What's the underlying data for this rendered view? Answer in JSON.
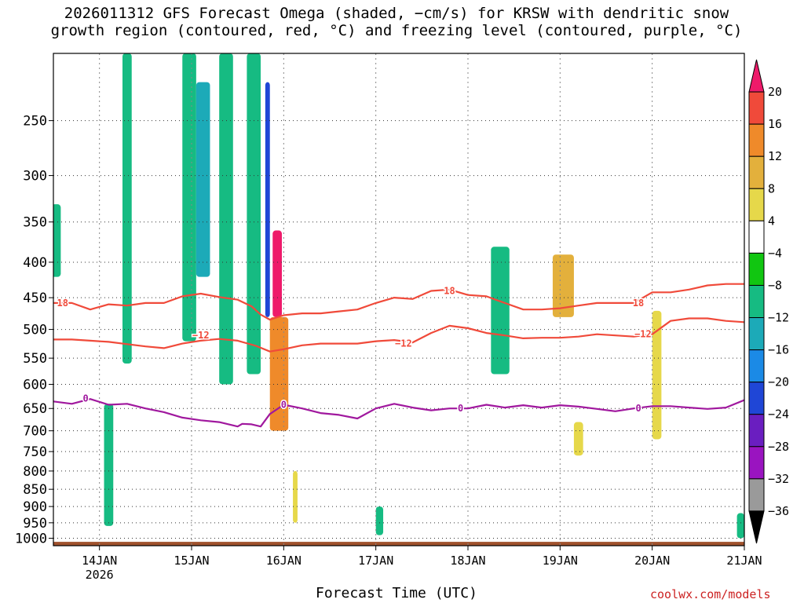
{
  "title": "2026011312 GFS Forecast Omega (shaded, −cm/s) for KRSW with dendritic snow\ngrowth region (contoured, red, °C) and freezing level (contoured, purple, °C)",
  "credit": "coolwx.com/models",
  "chart_data": {
    "type": "heatmap",
    "title": "2026011312 GFS Forecast Omega (shaded, −cm/s) for KRSW with dendritic snow growth region (contoured, red, °C) and freezing level (contoured, purple, °C)",
    "xlabel": "Forecast Time (UTC)",
    "ylabel": "",
    "y_scale": "log",
    "ylim": [
      1025,
      200
    ],
    "xlim": [
      "2026-01-13T12",
      "2026-01-21T00"
    ],
    "x_ticks": [
      {
        "label": "14JAN",
        "sub": "2026",
        "day": 14
      },
      {
        "label": "15JAN",
        "sub": "",
        "day": 15
      },
      {
        "label": "16JAN",
        "sub": "",
        "day": 16
      },
      {
        "label": "17JAN",
        "sub": "",
        "day": 17
      },
      {
        "label": "18JAN",
        "sub": "",
        "day": 18
      },
      {
        "label": "19JAN",
        "sub": "",
        "day": 19
      },
      {
        "label": "20JAN",
        "sub": "",
        "day": 20
      },
      {
        "label": "21JAN",
        "sub": "",
        "day": 21
      }
    ],
    "y_ticks": [
      250,
      300,
      350,
      400,
      450,
      500,
      550,
      600,
      650,
      700,
      750,
      800,
      850,
      900,
      950,
      1000
    ],
    "colorbar": {
      "labels": [
        "20",
        "16",
        "12",
        "8",
        "4",
        "−4",
        "−8",
        "−12",
        "−16",
        "−20",
        "−24",
        "−28",
        "−32",
        "−36"
      ],
      "colors": [
        "#ee1a6a",
        "#f04a3a",
        "#ef8a2a",
        "#e3b03c",
        "#e6d84a",
        "#ffffff",
        "#11c611",
        "#16bb82",
        "#1caab8",
        "#1b8ae6",
        "#1f46d6",
        "#6a1ec0",
        "#9a14c0",
        "#9a9a9a",
        "#000000"
      ]
    },
    "contours": [
      {
        "name": "-18",
        "color": "#f04a3a",
        "label": "18",
        "x": [
          13.5,
          13.7,
          13.9,
          14.1,
          14.3,
          14.5,
          14.7,
          14.9,
          15.1,
          15.3,
          15.5,
          15.65,
          15.75,
          15.85,
          16.0,
          16.2,
          16.4,
          16.6,
          16.8,
          17.0,
          17.2,
          17.4,
          17.6,
          17.8,
          18.0,
          18.2,
          18.4,
          18.6,
          18.8,
          19.0,
          19.2,
          19.4,
          19.6,
          19.8,
          20.0,
          20.2,
          20.4,
          20.6,
          20.8,
          21.0
        ],
        "y": [
          458,
          458,
          468,
          460,
          462,
          458,
          458,
          448,
          444,
          449,
          453,
          463,
          476,
          484,
          477,
          474,
          474,
          471,
          468,
          458,
          450,
          452,
          440,
          438,
          446,
          448,
          458,
          468,
          468,
          466,
          462,
          458,
          458,
          458,
          442,
          442,
          438,
          432,
          430,
          430
        ],
        "label_at": [
          [
            13.6,
            458
          ],
          [
            17.8,
            440
          ],
          [
            19.85,
            458
          ]
        ]
      },
      {
        "name": "-12",
        "color": "#f04a3a",
        "label": "−12",
        "x": [
          13.5,
          13.7,
          13.9,
          14.1,
          14.3,
          14.5,
          14.7,
          14.9,
          15.1,
          15.3,
          15.5,
          15.7,
          15.85,
          16.0,
          16.2,
          16.4,
          16.6,
          16.8,
          17.0,
          17.2,
          17.4,
          17.6,
          17.8,
          18.0,
          18.2,
          18.4,
          18.6,
          18.8,
          19.0,
          19.2,
          19.4,
          19.6,
          19.8,
          20.0,
          20.2,
          20.4,
          20.6,
          20.8,
          21.0
        ],
        "y": [
          517,
          517,
          519,
          521,
          525,
          529,
          532,
          524,
          519,
          516,
          519,
          528,
          538,
          534,
          527,
          524,
          524,
          524,
          520,
          518,
          522,
          506,
          494,
          498,
          506,
          510,
          515,
          514,
          514,
          512,
          508,
          510,
          512,
          508,
          486,
          482,
          482,
          486,
          488
        ],
        "label_at": [
          [
            15.1,
            510
          ],
          [
            17.3,
            524
          ],
          [
            19.9,
            508
          ]
        ]
      },
      {
        "name": "0",
        "color": "#a0189e",
        "label": "0",
        "x": [
          13.5,
          13.7,
          13.9,
          14.1,
          14.3,
          14.5,
          14.7,
          14.9,
          15.1,
          15.3,
          15.5,
          15.55,
          15.65,
          15.75,
          15.85,
          16.0,
          16.2,
          16.4,
          16.6,
          16.8,
          17.0,
          17.2,
          17.4,
          17.6,
          17.8,
          18.0,
          18.2,
          18.4,
          18.6,
          18.8,
          19.0,
          19.2,
          19.4,
          19.6,
          19.8,
          20.0,
          20.2,
          20.4,
          20.6,
          20.8,
          21.0
        ],
        "y": [
          635,
          640,
          630,
          642,
          640,
          650,
          658,
          670,
          676,
          680,
          690,
          684,
          685,
          690,
          662,
          642,
          650,
          660,
          664,
          672,
          650,
          640,
          648,
          654,
          650,
          650,
          642,
          648,
          643,
          648,
          643,
          646,
          651,
          656,
          650,
          645,
          645,
          648,
          651,
          648,
          632
        ],
        "label_at": [
          [
            13.85,
            629
          ],
          [
            16.0,
            642
          ],
          [
            17.92,
            650
          ],
          [
            19.85,
            650
          ]
        ]
      }
    ],
    "shaded_regions_omega": [
      {
        "value": -8,
        "x": [
          13.48,
          13.58
        ],
        "p": [
          330,
          420
        ]
      },
      {
        "value": -8,
        "x": [
          14.05,
          14.15
        ],
        "p": [
          640,
          960
        ]
      },
      {
        "value": -8,
        "x": [
          14.25,
          14.35
        ],
        "p": [
          200,
          560
        ]
      },
      {
        "value": -8,
        "x": [
          14.9,
          15.05
        ],
        "p": [
          200,
          520
        ]
      },
      {
        "value": -8,
        "x": [
          15.3,
          15.45
        ],
        "p": [
          200,
          600
        ]
      },
      {
        "value": -8,
        "x": [
          15.6,
          15.75
        ],
        "p": [
          200,
          580
        ]
      },
      {
        "value": -12,
        "x": [
          15.05,
          15.2
        ],
        "p": [
          220,
          420
        ]
      },
      {
        "value": -20,
        "x": [
          15.8,
          15.85
        ],
        "p": [
          220,
          480
        ]
      },
      {
        "value": -8,
        "x": [
          17.0,
          17.08
        ],
        "p": [
          900,
          990
        ]
      },
      {
        "value": -8,
        "x": [
          18.25,
          18.45
        ],
        "p": [
          380,
          580
        ]
      },
      {
        "value": -8,
        "x": [
          20.92,
          21.0
        ],
        "p": [
          920,
          1000
        ]
      },
      {
        "value": 20,
        "x": [
          15.88,
          15.98
        ],
        "p": [
          360,
          480
        ]
      },
      {
        "value": 12,
        "x": [
          15.85,
          16.05
        ],
        "p": [
          480,
          700
        ]
      },
      {
        "value": 8,
        "x": [
          18.92,
          19.15
        ],
        "p": [
          390,
          480
        ]
      },
      {
        "value": 4,
        "x": [
          16.1,
          16.15
        ],
        "p": [
          800,
          950
        ]
      },
      {
        "value": 4,
        "x": [
          19.15,
          19.25
        ],
        "p": [
          680,
          760
        ]
      },
      {
        "value": 4,
        "x": [
          20.0,
          20.1
        ],
        "p": [
          470,
          720
        ]
      }
    ]
  }
}
